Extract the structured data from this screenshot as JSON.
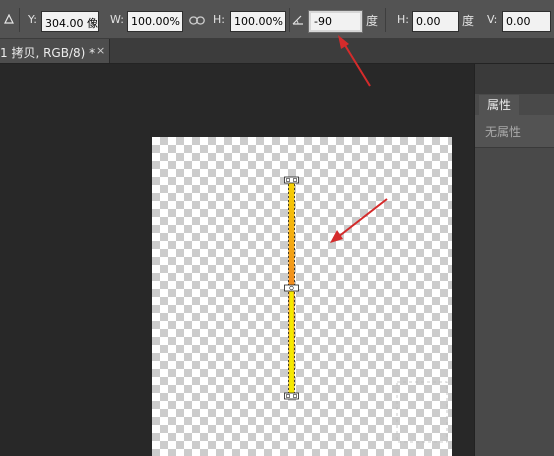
{
  "options_bar": {
    "ref_point_icon": "triangle-ref-icon",
    "y_label": "Y:",
    "y_value": "304.00 像",
    "w_label": "W:",
    "w_value": "100.00%",
    "link_icon": "link-icon",
    "h_label": "H:",
    "h_value": "100.00%",
    "angle_icon": "angle-icon",
    "angle_value": "-90",
    "angle_unit": "度",
    "skew_h_label": "H:",
    "skew_h_value": "0.00",
    "skew_h_unit": "度",
    "skew_v_label": "V:",
    "skew_v_value": "0.00"
  },
  "document_tab": {
    "title": "1 拷贝, RGB/8) *",
    "close": "×"
  },
  "properties_panel": {
    "tab_label": "属性",
    "empty_text": "无属性"
  },
  "colors": {
    "annotation_arrow": "#d42b2b",
    "layer_stroke": "#f2e600",
    "layer_gradient_top": "#f6c400",
    "layer_gradient_mid": "#f38a1c",
    "selection_handles": "#ffffff"
  }
}
